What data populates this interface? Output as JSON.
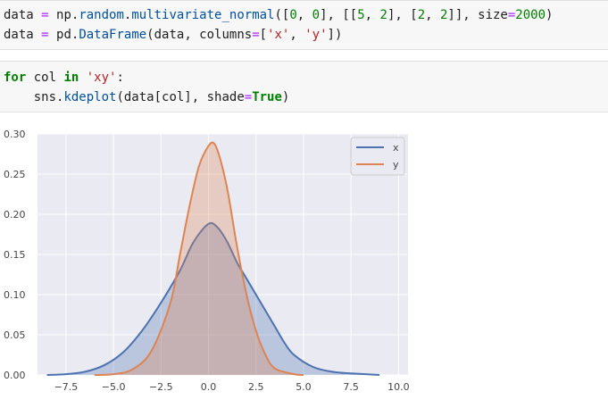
{
  "cells": {
    "cell1": {
      "line1": {
        "t1": "data",
        "t2": " ",
        "t3": "=",
        "t4": " np.",
        "t5": "random",
        "t6": ".",
        "t7": "multivariate_normal",
        "t8": "([",
        "t9": "0",
        "t10": ", ",
        "t11": "0",
        "t12": "], [[",
        "t13": "5",
        "t14": ", ",
        "t15": "2",
        "t16": "], [",
        "t17": "2",
        "t18": ", ",
        "t19": "2",
        "t20": "]], size",
        "t21": "=",
        "t22": "2000",
        "t23": ")"
      },
      "line2": {
        "t1": "data",
        "t2": " ",
        "t3": "=",
        "t4": " pd.",
        "t5": "DataFrame",
        "t6": "(data, columns",
        "t7": "=",
        "t8": "[",
        "t9": "'x'",
        "t10": ", ",
        "t11": "'y'",
        "t12": "])"
      }
    },
    "cell2": {
      "line1": {
        "t1": "for",
        "t2": " col ",
        "t3": "in",
        "t4": " ",
        "t5": "'xy'",
        "t6": ":"
      },
      "line2": {
        "t0": "    sns.",
        "t1": "kdeplot",
        "t2": "(data[col], shade",
        "t3": "=",
        "t4": "True",
        "t5": ")"
      }
    }
  },
  "chart_data": {
    "type": "area",
    "xlim": [
      -9,
      10.5
    ],
    "ylim": [
      0,
      0.3
    ],
    "xticks": [
      "−7.5",
      "−5.0",
      "−2.5",
      "0.0",
      "2.5",
      "5.0",
      "7.5",
      "10.0"
    ],
    "xtick_values": [
      -7.5,
      -5.0,
      -2.5,
      0.0,
      2.5,
      5.0,
      7.5,
      10.0
    ],
    "yticks": [
      "0.00",
      "0.05",
      "0.10",
      "0.15",
      "0.20",
      "0.25",
      "0.30"
    ],
    "ytick_values": [
      0.0,
      0.05,
      0.1,
      0.15,
      0.2,
      0.25,
      0.3
    ],
    "grid": true,
    "legend_position": "top-right",
    "series": [
      {
        "name": "x",
        "color": "#4c72b0",
        "points": [
          [
            -8.5,
            0.0
          ],
          [
            -7.5,
            0.001
          ],
          [
            -6.5,
            0.004
          ],
          [
            -5.5,
            0.012
          ],
          [
            -4.5,
            0.028
          ],
          [
            -3.5,
            0.055
          ],
          [
            -2.5,
            0.09
          ],
          [
            -1.5,
            0.13
          ],
          [
            -0.8,
            0.165
          ],
          [
            0.0,
            0.188
          ],
          [
            0.5,
            0.183
          ],
          [
            1.0,
            0.165
          ],
          [
            1.5,
            0.14
          ],
          [
            2.0,
            0.12
          ],
          [
            2.5,
            0.1
          ],
          [
            3.0,
            0.08
          ],
          [
            3.5,
            0.06
          ],
          [
            4.0,
            0.04
          ],
          [
            4.5,
            0.025
          ],
          [
            5.5,
            0.01
          ],
          [
            6.5,
            0.004
          ],
          [
            7.5,
            0.002
          ],
          [
            9.0,
            0.0
          ]
        ]
      },
      {
        "name": "y",
        "color": "#dd8452",
        "points": [
          [
            -6.0,
            0.0
          ],
          [
            -5.0,
            0.001
          ],
          [
            -4.0,
            0.007
          ],
          [
            -3.0,
            0.03
          ],
          [
            -2.0,
            0.09
          ],
          [
            -1.5,
            0.15
          ],
          [
            -1.0,
            0.21
          ],
          [
            -0.5,
            0.26
          ],
          [
            0.0,
            0.285
          ],
          [
            0.3,
            0.288
          ],
          [
            0.6,
            0.27
          ],
          [
            1.0,
            0.23
          ],
          [
            1.5,
            0.16
          ],
          [
            2.0,
            0.1
          ],
          [
            2.5,
            0.055
          ],
          [
            3.0,
            0.025
          ],
          [
            3.5,
            0.008
          ],
          [
            4.5,
            0.001
          ],
          [
            5.0,
            0.0
          ]
        ]
      }
    ]
  }
}
